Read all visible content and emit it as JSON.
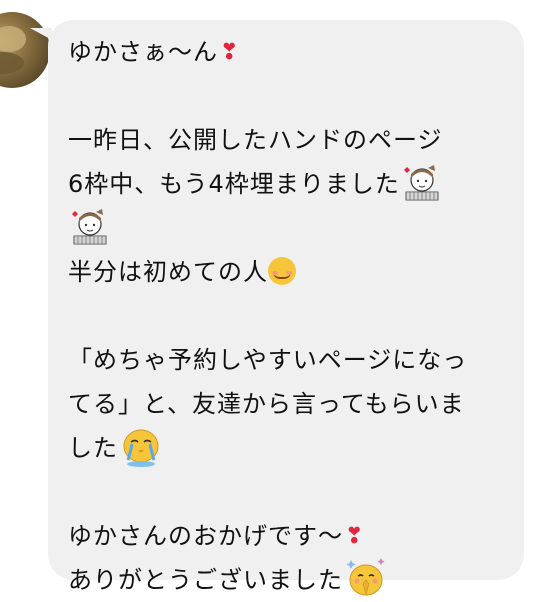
{
  "message": {
    "line1": "ゆかさぁ〜ん",
    "line2": "一昨日、公開したハンドのページ",
    "line3": "6枠中、もう4枠埋まりました",
    "line4": "半分は初めての人",
    "line5": "「めちゃ予約しやすいページになっ",
    "line6": "てる」と、友達から言ってもらいま",
    "line7": "した",
    "line8": "ゆかさんのおかげです〜",
    "line9": "ありがとうございました"
  },
  "icons": {
    "heart": "heart-exclamation-icon",
    "girl": "girl-character-emoji",
    "smile": "smiling-face-icon",
    "crying": "crying-chick-sticker",
    "praying": "praying-chick-sticker"
  },
  "colors": {
    "bubble": "#f0f0f0",
    "heart": "#e0263c",
    "text": "#111111"
  }
}
